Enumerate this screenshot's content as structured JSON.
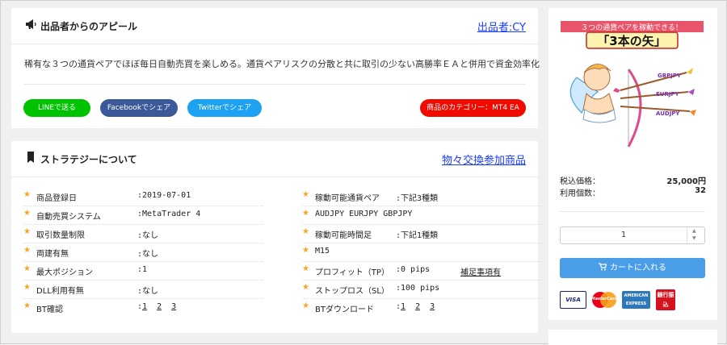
{
  "appeal": {
    "title": "出品者からのアピール",
    "seller_link": "出品者:CY",
    "text": "稀有な３つの通貨ペアでほぼ毎日自動売買を楽しめる。通貨ペアリスクの分散と共に取引の少ない高勝率ＥＡと併用で資金効率化",
    "buttons": {
      "line": "LINEで送る",
      "facebook": "Facebookでシェア",
      "twitter": "Twitterでシェア",
      "category": "商品のカテゴリー：MT4 EA"
    }
  },
  "strategy": {
    "title": "ストラテジーについて",
    "link": "物々交換参加商品",
    "left": [
      {
        "label": "商品登録日",
        "value": ":2019-07-01"
      },
      {
        "label": "自動売買システム",
        "value": ":MetaTrader 4"
      },
      {
        "label": "取引数量制限",
        "value": ":なし"
      },
      {
        "label": "両建有無",
        "value": ":なし"
      },
      {
        "label": "最大ポジション",
        "value": ":1"
      },
      {
        "label": "DLL利用有無",
        "value": ":なし"
      }
    ],
    "bt": {
      "label": "BT確認",
      "prefix": ":",
      "links": [
        "1",
        "2",
        "3"
      ]
    },
    "right": [
      {
        "label": "稼動可能通貨ペア",
        "value": ":下記3種類"
      },
      {
        "label": "AUDJPY EURJPY GBPJPY",
        "value": ""
      },
      {
        "label": "稼動可能時間足",
        "value": ":下記1種類"
      },
      {
        "label": "M15",
        "value": ""
      },
      {
        "label": "プロフィット（TP）",
        "value": ":0 pips"
      },
      {
        "label": "ストップロス（SL）",
        "value": ":100 pips"
      }
    ],
    "tp_extra": "補足事項有",
    "btdl": {
      "label": "BTダウンロード",
      "prefix": ":",
      "links": [
        "1",
        "2",
        "3"
      ]
    }
  },
  "product": {
    "banner_caption": "３つの通貨ペアを稼動できる！",
    "banner_title": "「3本の矢」",
    "arrow_labels": [
      "GBPJPY",
      "EURJPY",
      "AUDJPY"
    ],
    "price_label": "税込価格：",
    "price": "25,000円",
    "users_label": "利用個数：",
    "users": "32",
    "quantity": "1",
    "cart_label": "カートに入れる",
    "payments": [
      "VISA",
      "MasterCard",
      "AMERICAN EXPRESS",
      "銀行振込"
    ]
  },
  "colors": {
    "line": "#00c300",
    "facebook": "#3b5998",
    "twitter": "#1da1f2",
    "category": "#f00a00",
    "cart": "#4a9ee8",
    "star": "#f5a623",
    "link": "#1a3cff"
  }
}
